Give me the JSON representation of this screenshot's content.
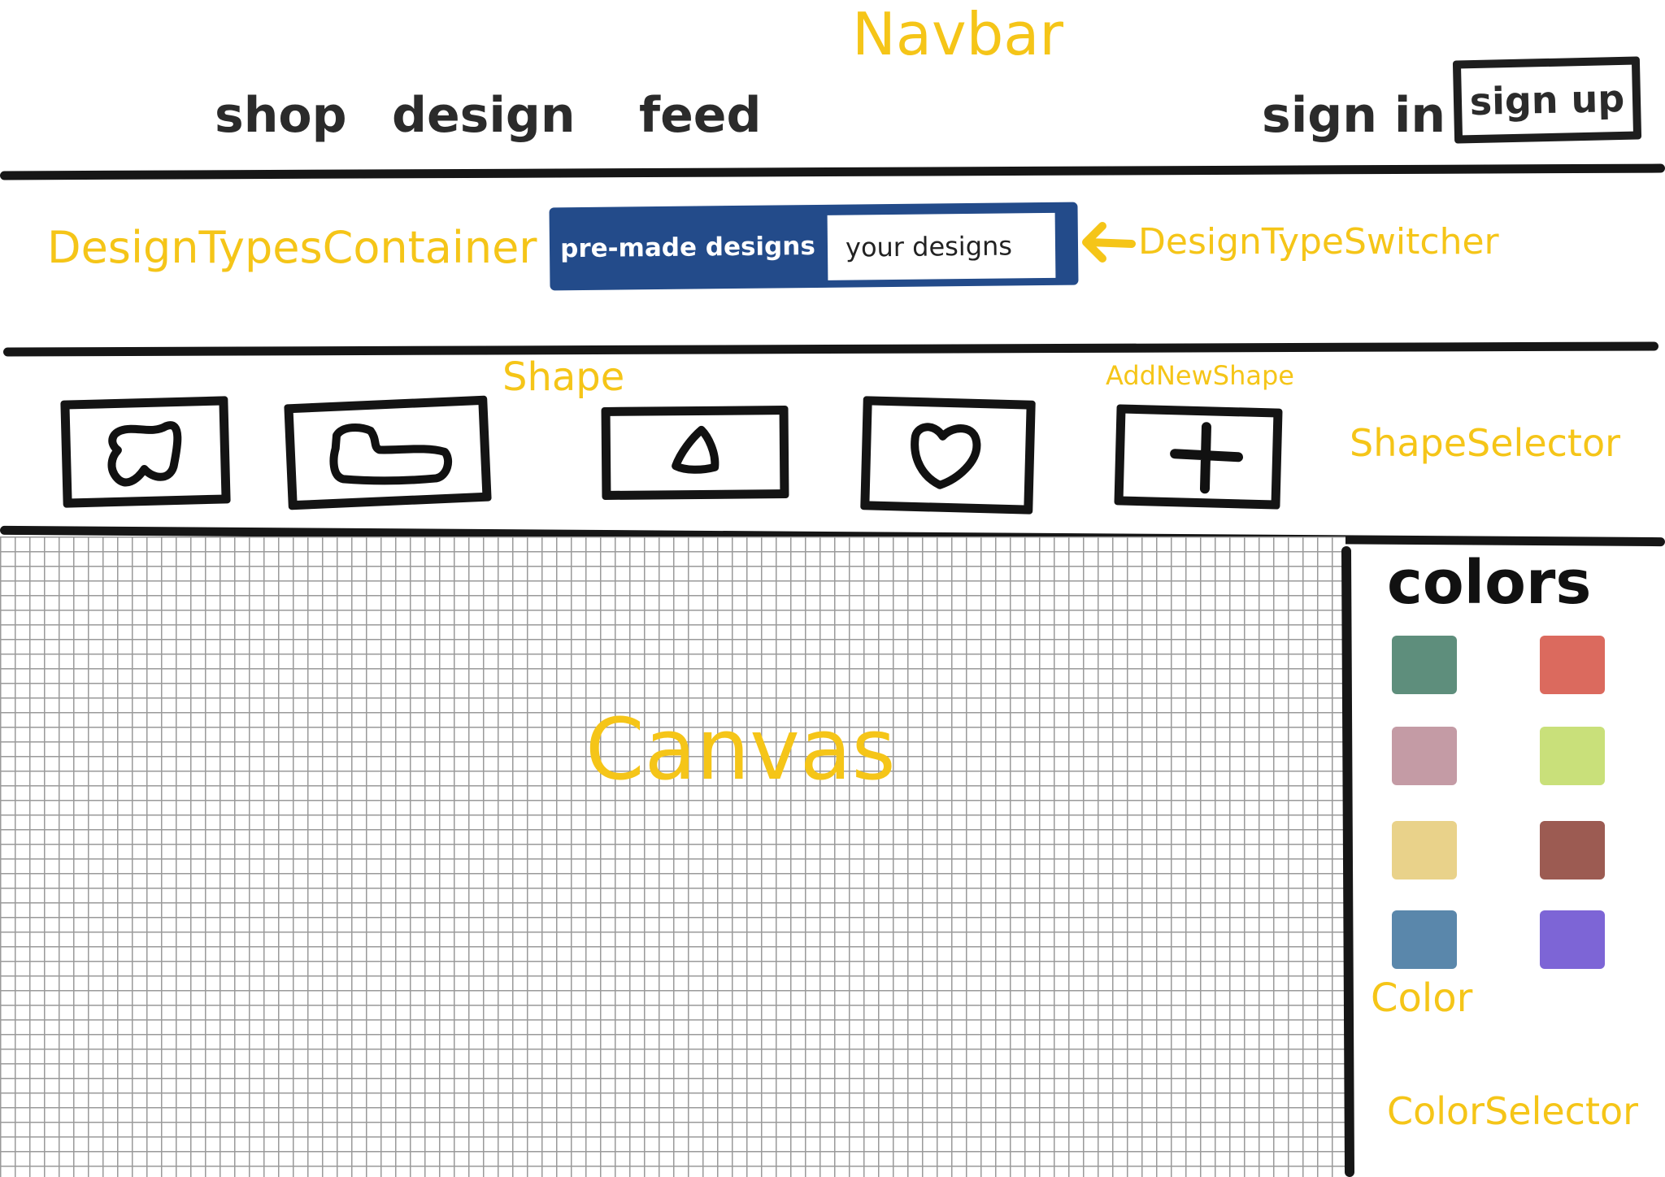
{
  "annotations": {
    "navbar": "Navbar",
    "design_types_container": "DesignTypesContainer",
    "design_type_switcher": "DesignTypeSwitcher",
    "shape": "Shape",
    "add_new_shape": "AddNewShape",
    "shape_selector": "ShapeSelector",
    "canvas": "Canvas",
    "color": "Color",
    "color_selector": "ColorSelector"
  },
  "navbar": {
    "links": [
      "shop",
      "design",
      "feed"
    ],
    "sign_in": "sign in",
    "sign_up": "sign up"
  },
  "design_switcher": {
    "option_premade": "pre-made designs",
    "option_yours": "your designs"
  },
  "shapes": [
    {
      "icon": "blob-shape-icon"
    },
    {
      "icon": "boot-shape-icon"
    },
    {
      "icon": "triangle-shape-icon"
    },
    {
      "icon": "heart-shape-icon"
    },
    {
      "icon": "plus-icon"
    }
  ],
  "colors_panel": {
    "title": "colors",
    "swatches": [
      "#5e8e7c",
      "#db6a5e",
      "#c49ba5",
      "#c9e07a",
      "#e9d28a",
      "#9c5b52",
      "#5a87ab",
      "#7d65d6"
    ]
  },
  "accent_color": "#f5c518",
  "switcher_color": "#234b8a"
}
